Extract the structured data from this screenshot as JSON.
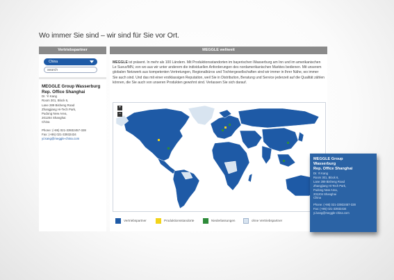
{
  "headline": "Wo immer Sie sind – wir sind für Sie vor Ort.",
  "sidebar": {
    "header": "Vertriebspartner",
    "select_value": "China",
    "search_placeholder": "search",
    "contact": {
      "name_line1": "MEGGLE Group Wasserburg",
      "name_line2": "Rep. Office Shanghai",
      "lines": [
        "Dr. Yi Kang",
        "Room 301, Block 6,",
        "Lane 289 Bisheng Road",
        "Zhangjiang Hi-Tech Park,",
        "Pudong New Area,",
        "201204 Shanghai",
        "China"
      ],
      "phone": "Phone: (+86) 021-33932457-328",
      "fax": "Fax: (+86) 021-33932434",
      "email": "yi.kang@meggle-china.com"
    }
  },
  "main": {
    "header": "MEGGLE weltweit",
    "intro_lead": "MEGGLE",
    "intro": " ist präsent. In mehr als 100 Ländern. Mit Produktionsstandorten im bayerischen Wasserburg am Inn und im amerikanischen Le Sueur/MN, von wo aus wir unter anderem die individuellen Anforderungen des nordamerikanischen Marktes bedienen. Mit unserem globalen Netzwerk aus kompetenten Vertretungen, Regionalbüros und Tochtergesellschaften sind wir immer in Ihrer Nähe, wo immer Sie auch sind. Und das mit einer erstklassigen Reputation, weil Sie in Distribution, Beratung und Service jederzeit auf die Qualität zählen können, die Sie auch von unseren Produkten gewohnt sind. Verlassen Sie sich darauf.",
    "zoom_in": "+",
    "zoom_out": "−"
  },
  "legend": [
    {
      "label": "Vertriebspartner",
      "color": "#1e5aa6"
    },
    {
      "label": "Produktionsstandorte",
      "color": "#f2d31a"
    },
    {
      "label": "Niederlassungen",
      "color": "#2e8b3a"
    },
    {
      "label": "ohne Vertriebspartner",
      "color": "#d8e4f0"
    }
  ],
  "popup": {
    "title_line1": "MEGGLE Group",
    "title_line2": "Wasserburg",
    "title_line3": "Rep. Office Shanghai",
    "lines": [
      "Dr. Yi Kang",
      "Room 301, Block 6,",
      "Lane 289 Bisheng Road",
      "Zhangjiang Hi-Tech Park,",
      "Pudong New Area,",
      "201204 Shanghai",
      "China"
    ],
    "phone": "Phone: (+86) 021-33932457-328",
    "fax": "Fax: (+86) 021-33932434",
    "email": "yi.kang@meggle-china.com"
  },
  "colors": {
    "partner": "#1e5aa6",
    "no_partner": "#d8e4f0",
    "production": "#f2d31a",
    "branch": "#2e8b3a",
    "header_grey": "#8a8a8a"
  }
}
